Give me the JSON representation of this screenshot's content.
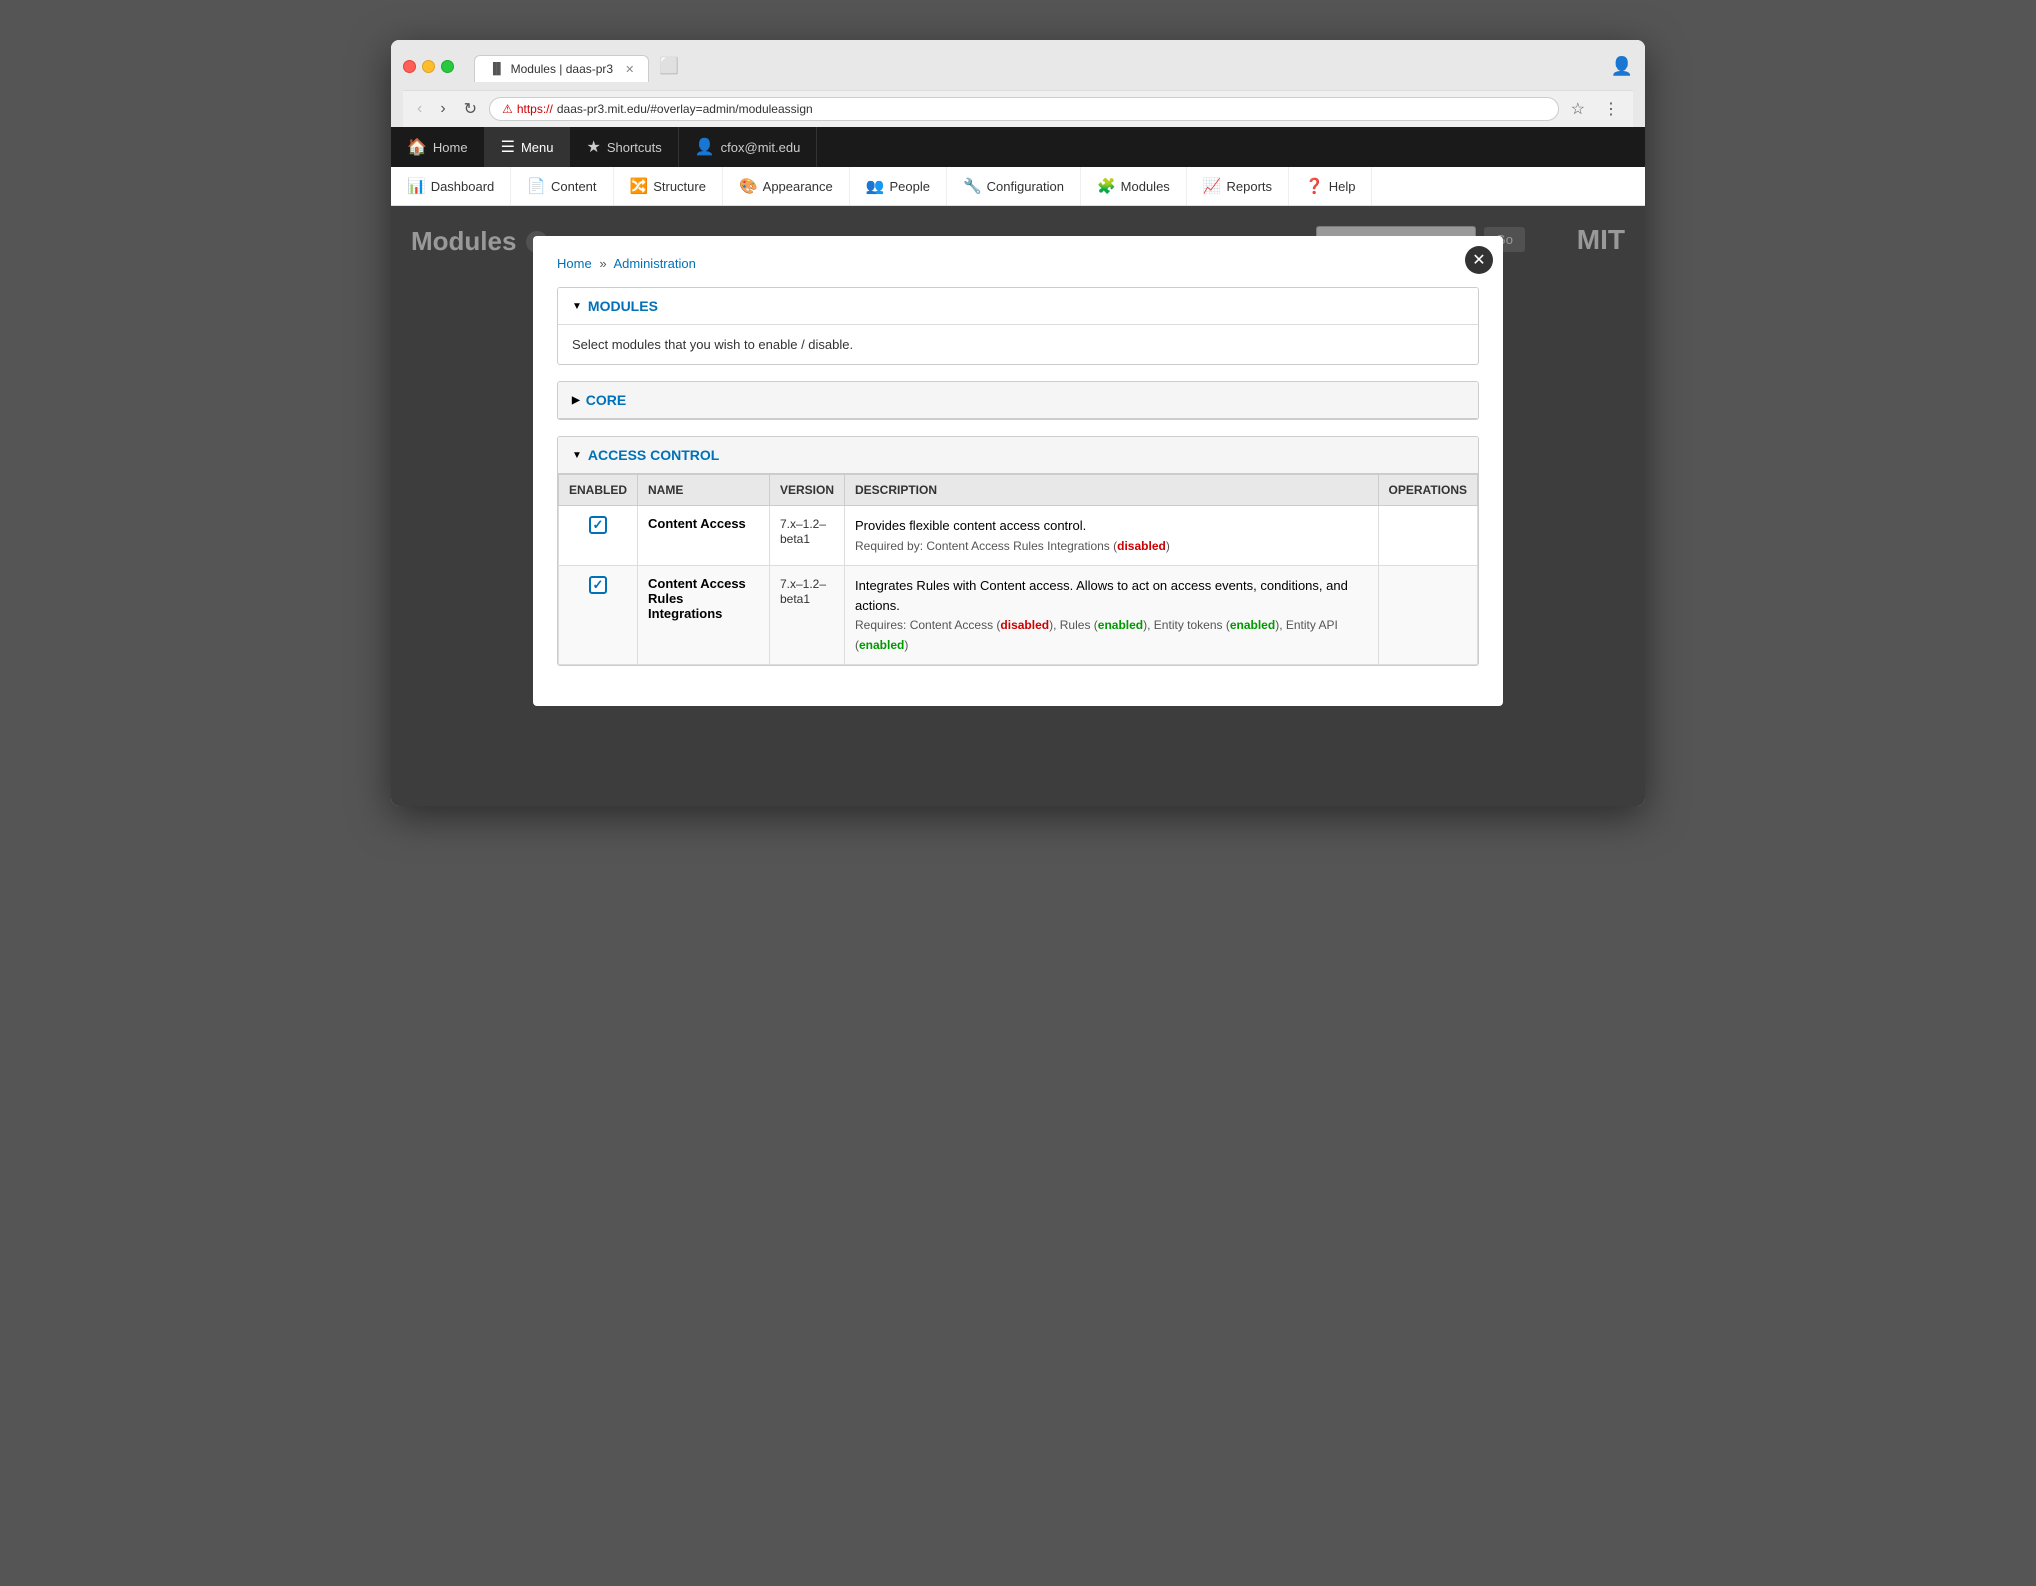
{
  "browser": {
    "tab_title": "Modules | daas-pr3",
    "url_warning": "⚠",
    "url_https": "https://",
    "url_rest": "daas-pr3.mit.edu/#overlay=admin/moduleassign",
    "profile_icon": "👤"
  },
  "drupal_navbar": {
    "items": [
      {
        "id": "home",
        "icon": "🏠",
        "label": "Home"
      },
      {
        "id": "menu",
        "icon": "☰",
        "label": "Menu",
        "active": true
      },
      {
        "id": "shortcuts",
        "icon": "★",
        "label": "Shortcuts"
      },
      {
        "id": "user",
        "icon": "👤",
        "label": "cfox@mit.edu"
      }
    ]
  },
  "drupal_menubar": {
    "items": [
      {
        "id": "dashboard",
        "icon": "📊",
        "label": "Dashboard"
      },
      {
        "id": "content",
        "icon": "📄",
        "label": "Content"
      },
      {
        "id": "structure",
        "icon": "🔀",
        "label": "Structure"
      },
      {
        "id": "appearance",
        "icon": "🎨",
        "label": "Appearance"
      },
      {
        "id": "people",
        "icon": "👥",
        "label": "People"
      },
      {
        "id": "configuration",
        "icon": "🔧",
        "label": "Configuration"
      },
      {
        "id": "modules",
        "icon": "🧩",
        "label": "Modules"
      },
      {
        "id": "reports",
        "icon": "📈",
        "label": "Reports"
      },
      {
        "id": "help",
        "icon": "❓",
        "label": "Help"
      }
    ]
  },
  "page": {
    "title": "Modules",
    "search_placeholder": "",
    "go_button": "Go",
    "mit_logo": "MIT"
  },
  "breadcrumb": {
    "home": "Home",
    "separator": "»",
    "admin": "Administration"
  },
  "modules_section": {
    "triangle": "▼",
    "title": "MODULES",
    "description": "Select modules that you wish to enable / disable."
  },
  "core_section": {
    "triangle": "▶",
    "title": "CORE"
  },
  "access_control_section": {
    "triangle": "▼",
    "title": "ACCESS CONTROL",
    "table_headers": {
      "enabled": "ENABLED",
      "name": "NAME",
      "version": "VERSION",
      "description": "DESCRIPTION",
      "operations": "OPERATIONS"
    },
    "rows": [
      {
        "enabled": true,
        "name": "Content Access",
        "version": "7.x–1.2–\nbeta1",
        "description": "Provides flexible content access control.",
        "required_by": "Required by: Content Access Rules Integrations",
        "required_status": "disabled",
        "has_arrow": true
      },
      {
        "enabled": true,
        "name": "Content Access\nRules Integrations",
        "version": "7.x–1.2–\nbeta1",
        "description": "Integrates Rules with Content access. Allows to act on access events, conditions, and actions.",
        "requires": "Requires: Content Access",
        "requires_status": "disabled",
        "requires2": "Rules",
        "requires2_status": "enabled",
        "requires3": "Entity tokens",
        "requires3_status": "enabled",
        "requires4": "Entity API",
        "requires4_status": "enabled",
        "has_arrow": true
      }
    ]
  },
  "close_button": "✕"
}
